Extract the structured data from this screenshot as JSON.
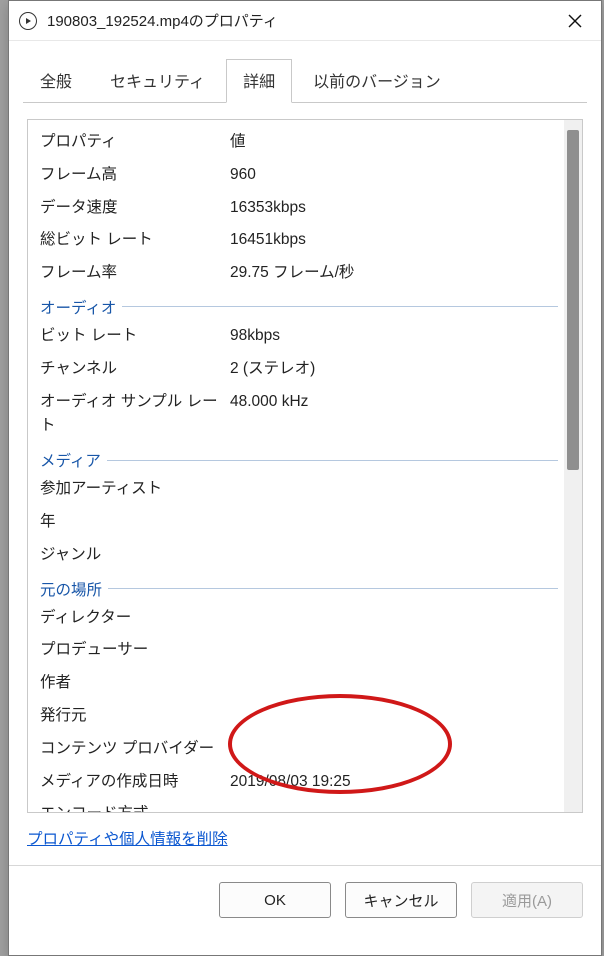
{
  "window": {
    "title": "190803_192524.mp4のプロパティ"
  },
  "tabs": {
    "general": "全般",
    "security": "セキュリティ",
    "details": "詳細",
    "previous": "以前のバージョン",
    "active": "details"
  },
  "headers": {
    "property": "プロパティ",
    "value": "値"
  },
  "rows_top": [
    {
      "label": "フレーム高",
      "value": "960"
    },
    {
      "label": "データ速度",
      "value": "16353kbps"
    },
    {
      "label": "総ビット レート",
      "value": "16451kbps"
    },
    {
      "label": "フレーム率",
      "value": "29.75 フレーム/秒"
    }
  ],
  "section_audio": "オーディオ",
  "rows_audio": [
    {
      "label": "ビット レート",
      "value": "98kbps"
    },
    {
      "label": "チャンネル",
      "value": "2 (ステレオ)"
    },
    {
      "label": "オーディオ サンプル レート",
      "value": "48.000 kHz"
    }
  ],
  "section_media": "メディア",
  "rows_media": [
    {
      "label": "参加アーティスト",
      "value": ""
    },
    {
      "label": "年",
      "value": ""
    },
    {
      "label": "ジャンル",
      "value": ""
    }
  ],
  "section_origin": "元の場所",
  "rows_origin": [
    {
      "label": "ディレクター",
      "value": ""
    },
    {
      "label": "プロデューサー",
      "value": ""
    },
    {
      "label": "作者",
      "value": ""
    },
    {
      "label": "発行元",
      "value": ""
    },
    {
      "label": "コンテンツ プロバイダー",
      "value": ""
    },
    {
      "label": "メディアの作成日時",
      "value": "2019/08/03 19:25"
    },
    {
      "label": "エンコード方式",
      "value": ""
    }
  ],
  "link": "プロパティや個人情報を削除",
  "buttons": {
    "ok": "OK",
    "cancel": "キャンセル",
    "apply": "適用(A)"
  }
}
